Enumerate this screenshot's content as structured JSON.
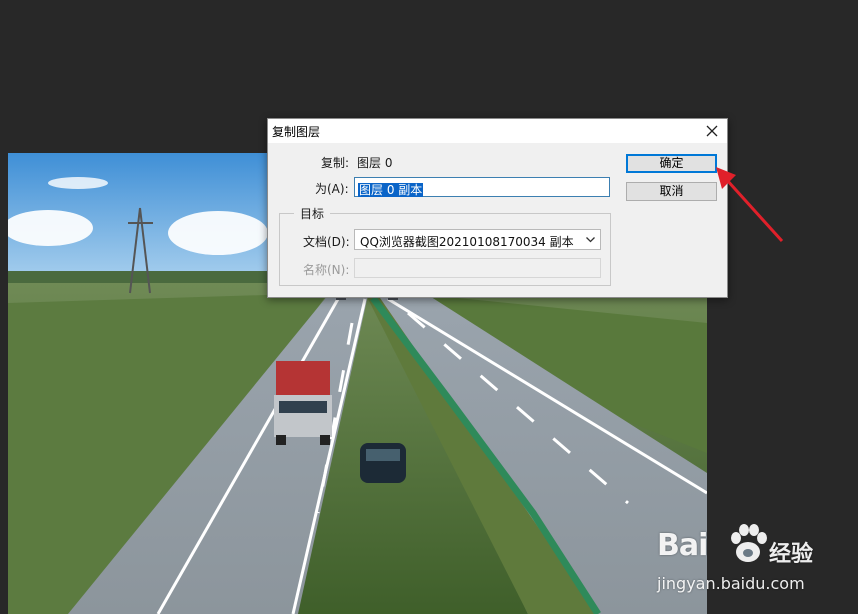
{
  "dialog": {
    "title": "复制图层",
    "copy_label": "复制:",
    "copy_value": "图层 0",
    "as_label": "为(A):",
    "as_value": "图层 0 副本",
    "target_legend": "目标",
    "document_label": "文档(D):",
    "document_value": "QQ浏览器截图20210108170034 副本",
    "name_label": "名称(N):",
    "name_value": "",
    "ok_label": "确定",
    "cancel_label": "取消"
  },
  "watermark": {
    "brand_left": "Bai",
    "brand_right": "经验",
    "url": "jingyan.baidu.com"
  },
  "colors": {
    "workspace_bg": "#282828",
    "dialog_bg": "#f0f0f0",
    "selection": "#0a64c8",
    "default_button_border": "#0078d7",
    "annotation_arrow": "#e0202a"
  },
  "icons": {
    "close": "close-icon",
    "dropdown": "chevron-down-icon",
    "annotation": "red-arrow-icon",
    "watermark_logo": "baidu-paw-icon"
  }
}
